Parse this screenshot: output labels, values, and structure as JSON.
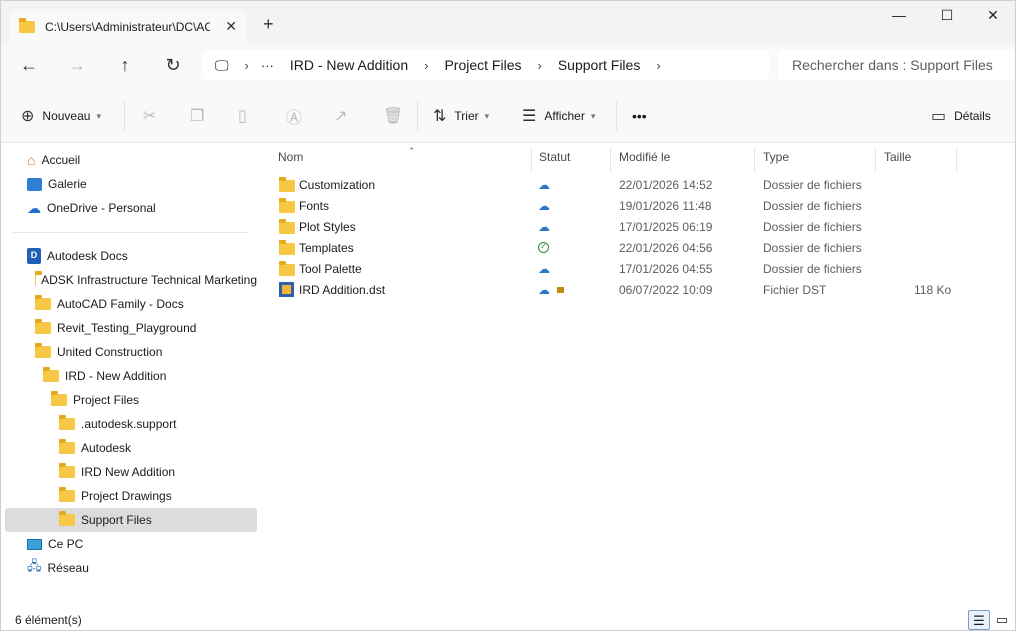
{
  "tab": {
    "title": "C:\\Users\\Administrateur\\DC\\ACCDocs\\"
  },
  "window_controls": {
    "minimize": "—",
    "maximize": "☐",
    "close": "✕"
  },
  "breadcrumb": [
    "IRD - New Addition",
    "Project Files",
    "Support Files"
  ],
  "search": {
    "placeholder": "Rechercher dans : Support Files"
  },
  "toolbar": {
    "new_label": "Nouveau",
    "sort_label": "Trier",
    "view_label": "Afficher",
    "more_label": "•••",
    "details_label": "Détails"
  },
  "nav": {
    "home": "Accueil",
    "gallery": "Galerie",
    "onedrive": "OneDrive - Personal",
    "autodesk_docs": "Autodesk Docs",
    "tree": [
      "ADSK Infrastructure Technical Marketing",
      "AutoCAD Family - Docs",
      "Revit_Testing_Playground",
      "United Construction",
      "IRD - New Addition",
      "Project Files",
      ".autodesk.support",
      "Autodesk",
      "IRD New Addition",
      "Project Drawings",
      "Support Files"
    ],
    "this_pc": "Ce PC",
    "network": "Réseau"
  },
  "columns": {
    "name": "Nom",
    "status": "Statut",
    "modified": "Modifié le",
    "type": "Type",
    "size": "Taille"
  },
  "files": [
    {
      "name": "Customization",
      "status": "cloud",
      "modified": "22/01/2026 14:52",
      "type": "Dossier de fichiers",
      "size": ""
    },
    {
      "name": "Fonts",
      "status": "cloud",
      "modified": "19/01/2026 11:48",
      "type": "Dossier de fichiers",
      "size": ""
    },
    {
      "name": "Plot Styles",
      "status": "cloud",
      "modified": "17/01/2025 06:19",
      "type": "Dossier de fichiers",
      "size": ""
    },
    {
      "name": "Templates",
      "status": "synced",
      "modified": "22/01/2026 04:56",
      "type": "Dossier de fichiers",
      "size": ""
    },
    {
      "name": "Tool Palette",
      "status": "cloud",
      "modified": "17/01/2026 04:55",
      "type": "Dossier de fichiers",
      "size": ""
    },
    {
      "name": "IRD Addition.dst",
      "status": "cloud-locked",
      "modified": "06/07/2022 10:09",
      "type": "Fichier DST",
      "size": "118 Ko"
    }
  ],
  "status": {
    "count": "6 élément(s)"
  },
  "colors": {
    "folder": "#f7c846",
    "cloud": "#2b77c9",
    "synced": "#2a8a3e",
    "selected": "#dcdcdc"
  }
}
